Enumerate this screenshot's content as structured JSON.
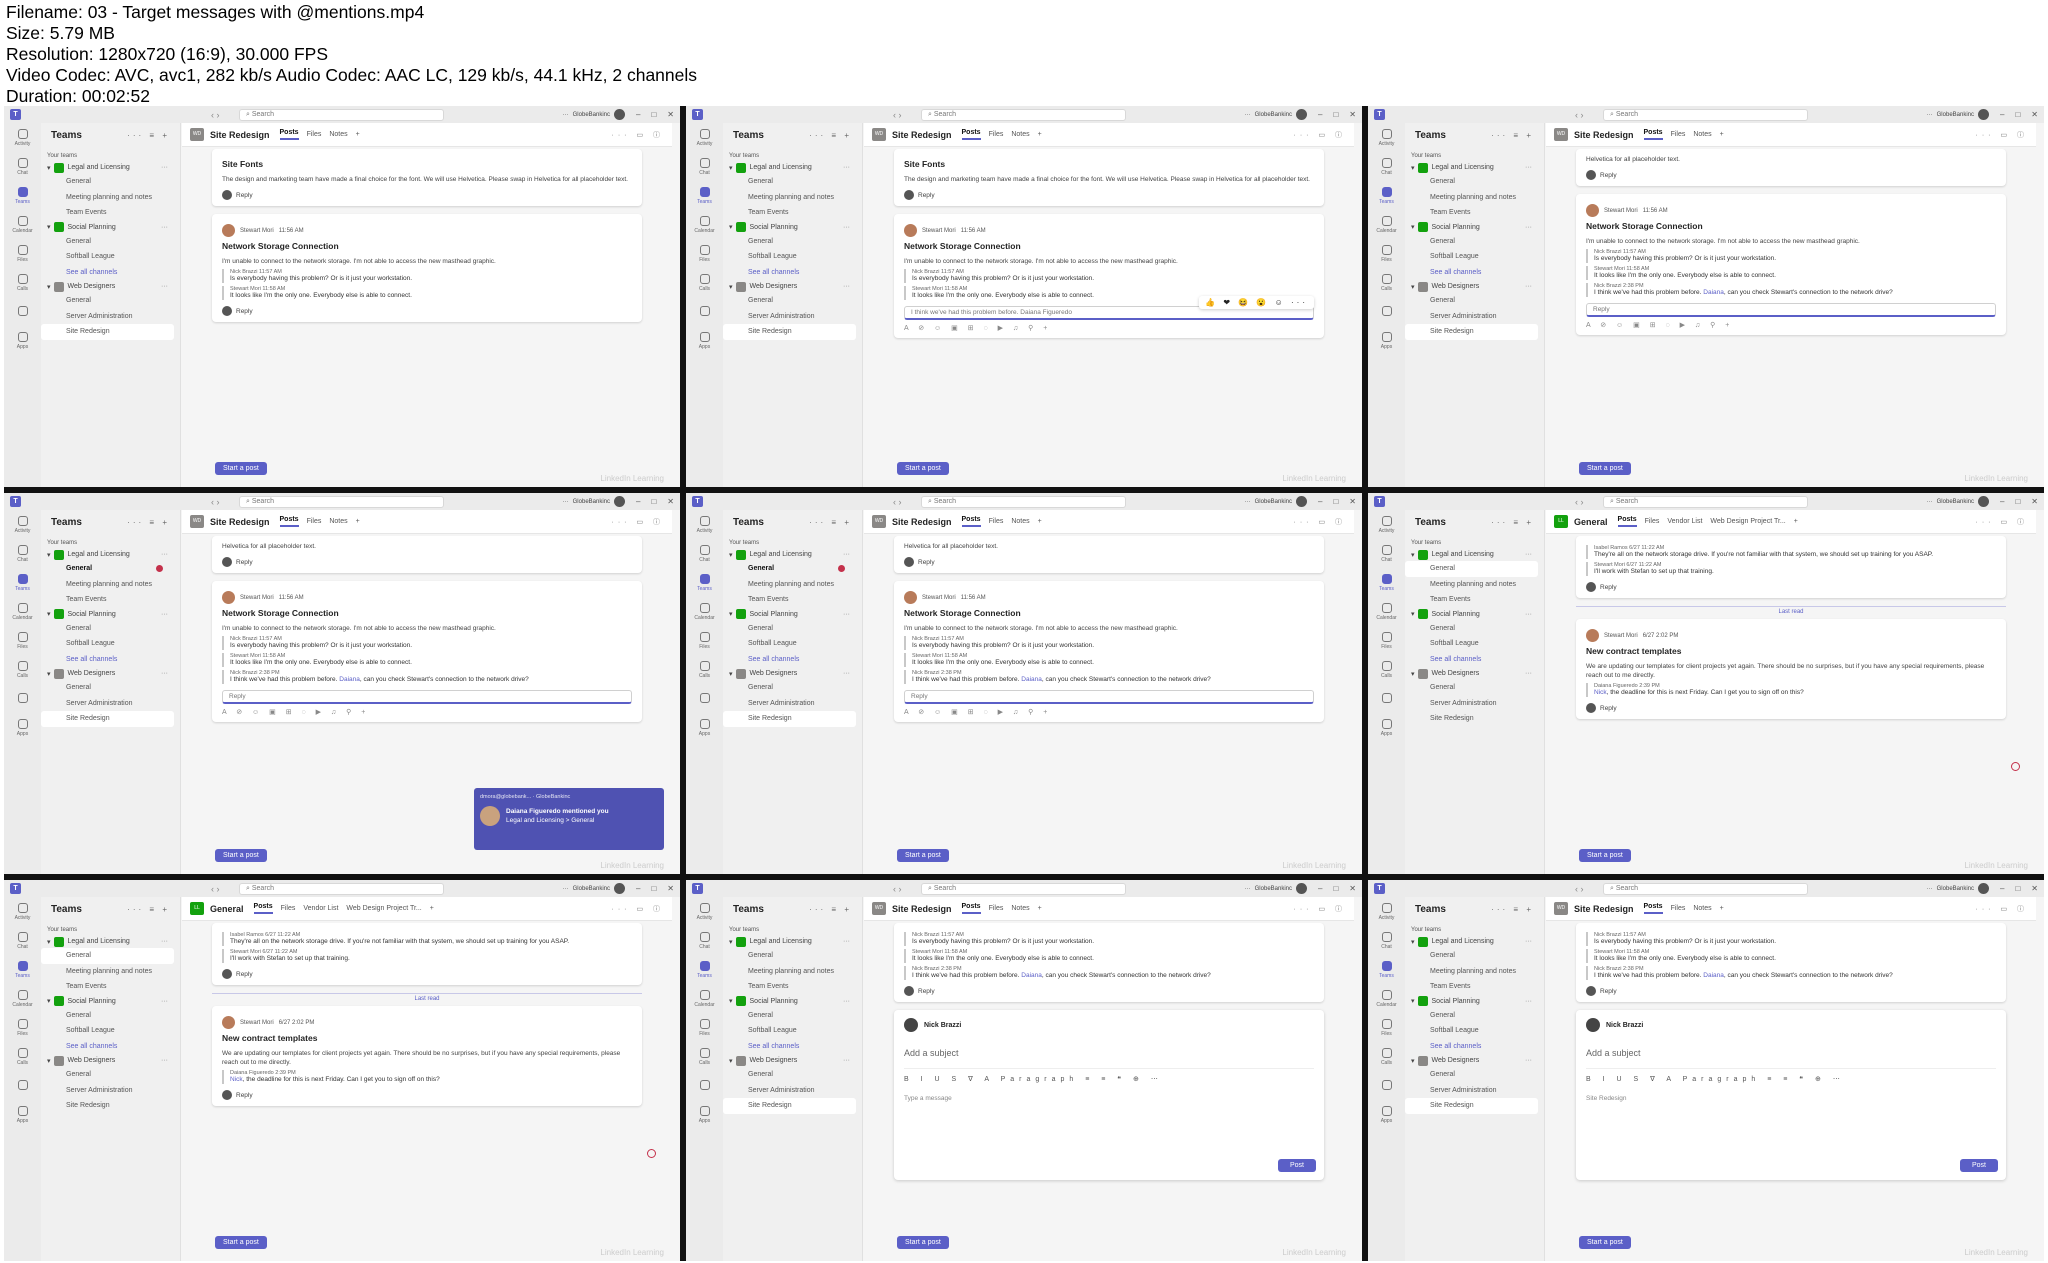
{
  "info": {
    "filename": "Filename: 03 - Target messages with @mentions.mp4",
    "size": "Size: 5.79 MB",
    "resolution": "Resolution: 1280x720 (16:9), 30.000 FPS",
    "codec": "Video Codec: AVC, avc1, 282 kb/s Audio Codec: AAC LC, 129 kb/s, 44.1 kHz, 2 channels",
    "duration": "Duration: 00:02:52"
  },
  "ui": {
    "search": "Search",
    "org": "GlobeBankinc",
    "teams_title": "Teams",
    "your_teams": "Your teams",
    "rail": [
      "Activity",
      "Chat",
      "Teams",
      "Calendar",
      "Files",
      "Calls",
      "",
      "Apps"
    ],
    "team1": "Legal and Licensing",
    "team2": "Social Planning",
    "team3": "Web Designers",
    "general": "General",
    "meeting": "Meeting planning and notes",
    "team_events": "Team Events",
    "softball": "Softball League",
    "see_all": "See all channels",
    "server_admin": "Server Administration",
    "site_redesign": "Site Redesign",
    "tab_posts": "Posts",
    "tab_files": "Files",
    "tab_notes": "Notes",
    "tab_vendor": "Vendor List",
    "tab_webdesign": "Web Design Project Tr...",
    "start_post": "Start a post",
    "reply": "Reply",
    "watermark": "LinkedIn Learning"
  },
  "posts": {
    "fonts_title": "Site Fonts",
    "fonts_body": "The design and marketing team have made a final choice for the font. We will use Helvetica. Please swap in Helvetica for all placeholder text.",
    "fonts_tail": "Helvetica for all placeholder text.",
    "stewart": "Stewart Mori",
    "stewart_time": "11:56 AM",
    "network_title": "Network Storage Connection",
    "network_body": "I'm unable to connect to the network storage. I'm not able to access the new masthead graphic.",
    "nick": "Nick Brazzi",
    "nick_time": "11:57 AM",
    "nick_text": "Is everybody having this problem? Or is it just your workstation.",
    "stewart_reply_time": "11:58 AM",
    "stewart_text": "It looks like I'm the only one. Everybody else is able to connect.",
    "nick_time2": "2:38 PM",
    "nick_text2_pre": "I think we've had this problem before.",
    "daiana": "Daiana",
    "nick_text2_post": ", can you check Stewart's connection to the network drive?",
    "typing": "I think we've had this problem before. Daiana Figueredo",
    "isabel": "Isabel Ramos",
    "isabel_time": "6/27 11:22 AM",
    "isabel_text": "They're all on the network storage drive. If you're not familiar with that system, we should set up training for you ASAP.",
    "stewart_time3": "6/27 11:22 AM",
    "stewart_text3": "I'll work with Stefan to set up that training.",
    "last_read": "Last read",
    "stewart_time4": "6/27 2:02 PM",
    "contract_title": "New contract templates",
    "contract_body": "We are updating our templates for client projects yet again. There should be no surprises, but if you have any special requirements, please reach out to me directly.",
    "daiana_full": "Daiana Figueredo",
    "daiana_time": "2:39 PM",
    "nick_mention": "Nick",
    "daiana_text": ", the deadline for this is next Friday. Can I get you to sign off on this?",
    "toast_from": "dmora@globebank... · GlobeBankinc",
    "toast_msg": "Daiana Figueredo mentioned you",
    "toast_path": "Legal and Licensing > General",
    "add_subject": "Add a subject",
    "type_message": "Type a message",
    "site_redesign_tag": "Site Redesign",
    "post_btn": "Post",
    "paragraph": "Paragraph"
  }
}
